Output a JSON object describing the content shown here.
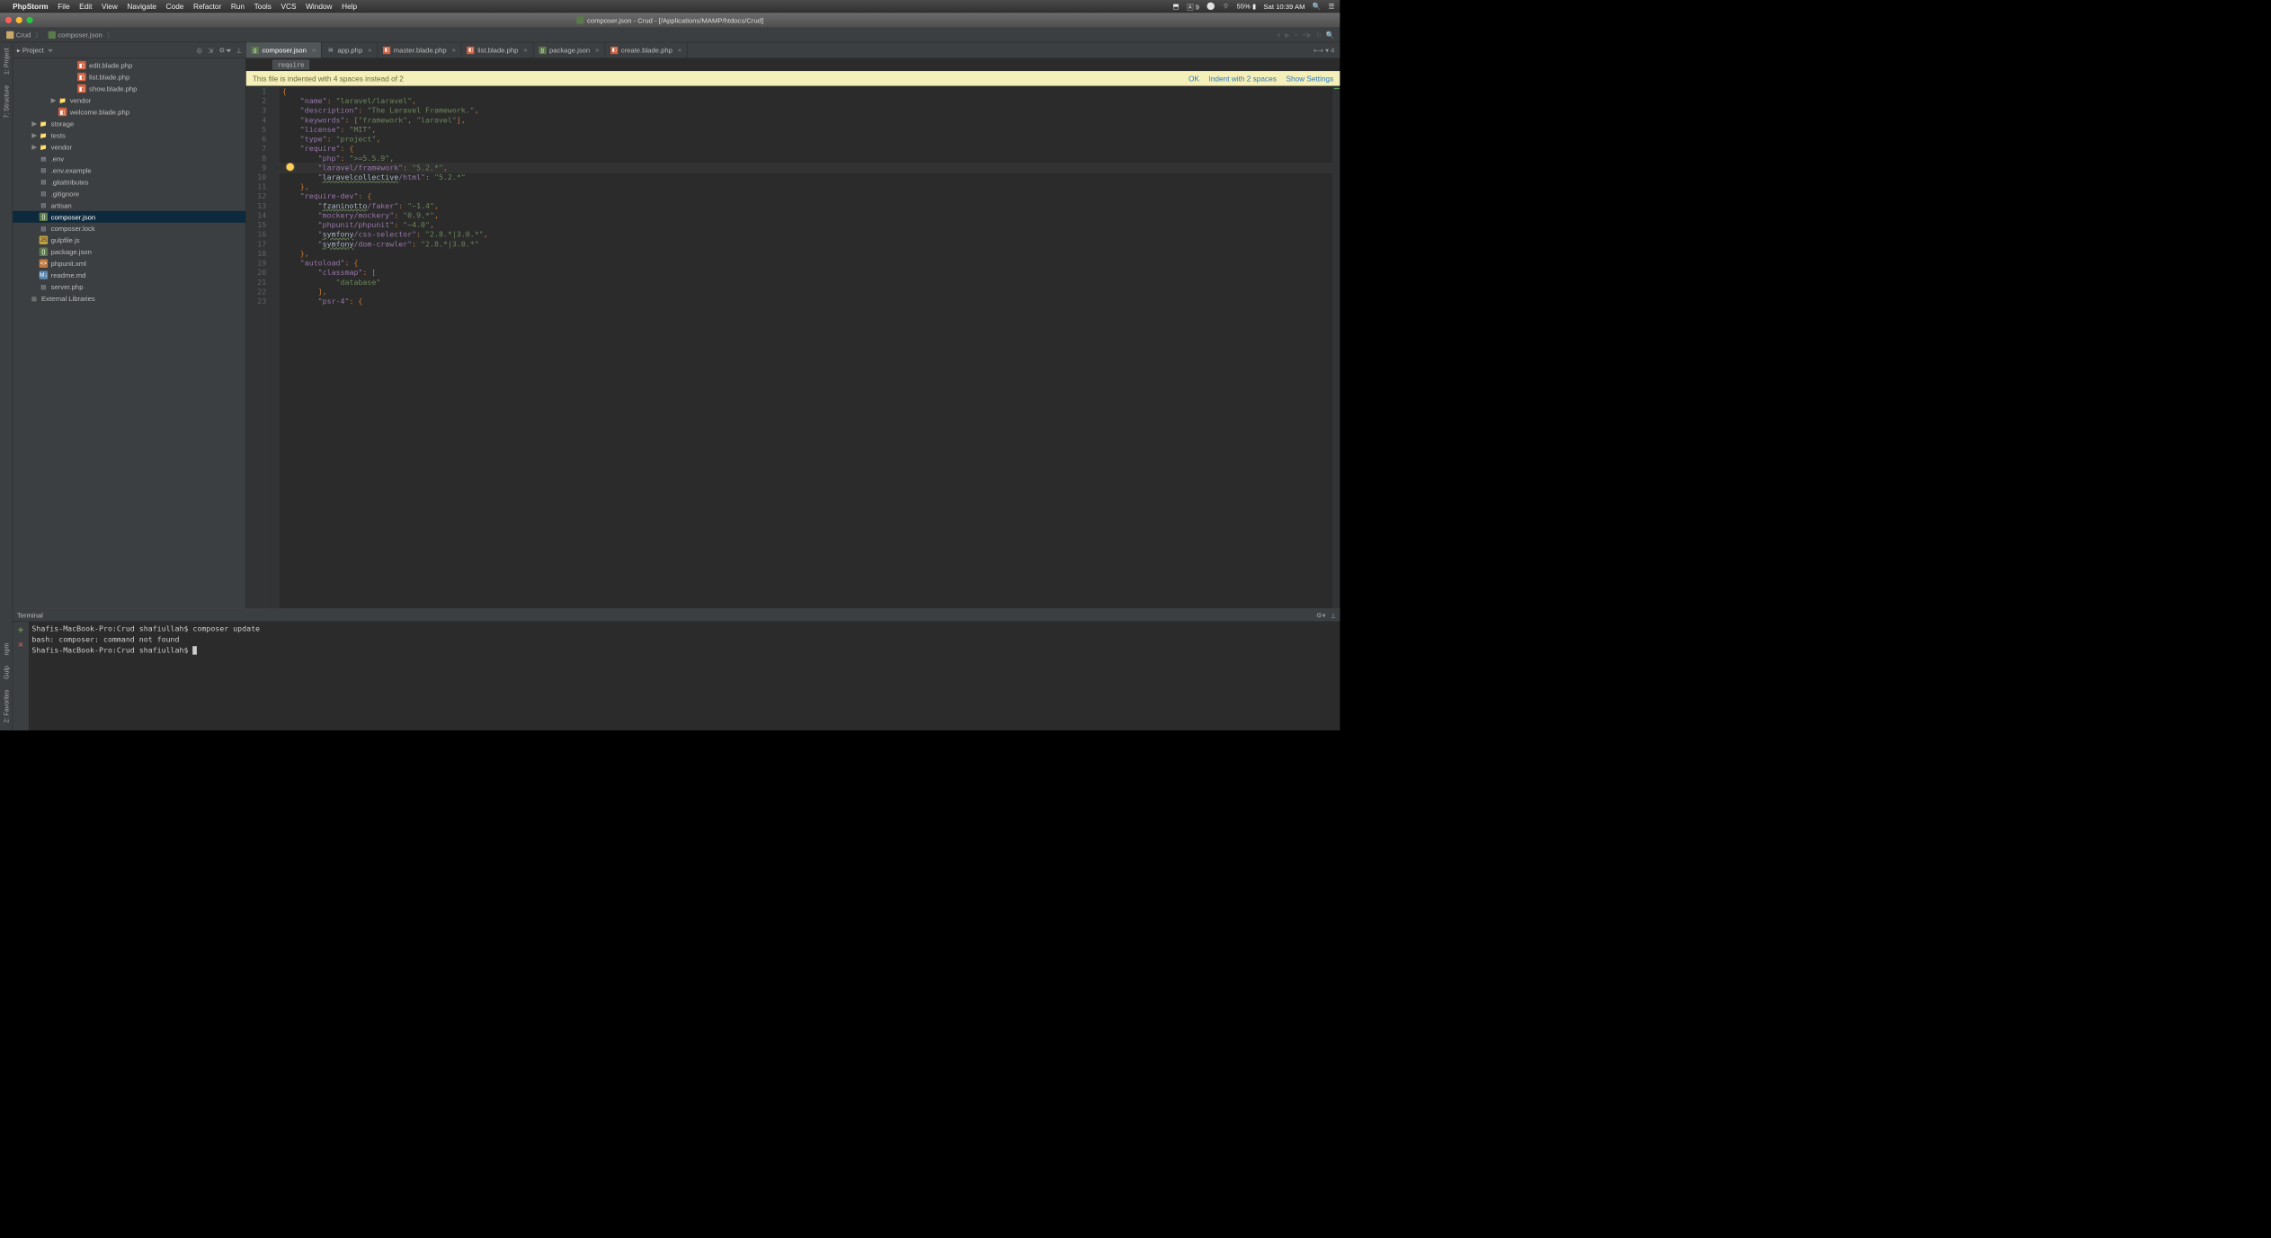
{
  "menubar": {
    "app": "PhpStorm",
    "items": [
      "File",
      "Edit",
      "View",
      "Navigate",
      "Code",
      "Refactor",
      "Run",
      "Tools",
      "VCS",
      "Window",
      "Help"
    ],
    "right": {
      "notif": "9",
      "battery": "55%",
      "time": "Sat 10:39 AM"
    }
  },
  "window": {
    "title": "composer.json - Crud - [/Applications/MAMP/htdocs/Crud]"
  },
  "breadcrumbs": {
    "root": "Crud",
    "file": "composer.json"
  },
  "sidebar": {
    "tabs": [
      "1: Project",
      "7: Structure"
    ],
    "bottom": [
      "npm",
      "Gulp",
      "2: Favorites"
    ]
  },
  "project": {
    "title": "Project",
    "tree": [
      {
        "d": 6,
        "t": "blade",
        "n": "edit.blade.php"
      },
      {
        "d": 6,
        "t": "blade",
        "n": "list.blade.php"
      },
      {
        "d": 6,
        "t": "blade",
        "n": "show.blade.php"
      },
      {
        "d": 4,
        "t": "folder",
        "n": "vendor",
        "arrow": "▶"
      },
      {
        "d": 4,
        "t": "blade",
        "n": "welcome.blade.php"
      },
      {
        "d": 2,
        "t": "folder",
        "n": "storage",
        "arrow": "▶"
      },
      {
        "d": 2,
        "t": "folder",
        "n": "tests",
        "arrow": "▶"
      },
      {
        "d": 2,
        "t": "folder",
        "n": "vendor",
        "arrow": "▶"
      },
      {
        "d": 2,
        "t": "file",
        "n": ".env"
      },
      {
        "d": 2,
        "t": "file",
        "n": ".env.example"
      },
      {
        "d": 2,
        "t": "file",
        "n": ".gitattributes"
      },
      {
        "d": 2,
        "t": "file",
        "n": ".gitignore"
      },
      {
        "d": 2,
        "t": "file",
        "n": "artisan"
      },
      {
        "d": 2,
        "t": "json",
        "n": "composer.json",
        "sel": true
      },
      {
        "d": 2,
        "t": "file",
        "n": "composer.lock"
      },
      {
        "d": 2,
        "t": "js",
        "n": "gulpfile.js"
      },
      {
        "d": 2,
        "t": "json",
        "n": "package.json"
      },
      {
        "d": 2,
        "t": "xml",
        "n": "phpunit.xml"
      },
      {
        "d": 2,
        "t": "md",
        "n": "readme.md"
      },
      {
        "d": 2,
        "t": "file",
        "n": "server.php"
      },
      {
        "d": 1,
        "t": "lib",
        "n": "External Libraries"
      }
    ]
  },
  "tabs": [
    {
      "label": "composer.json",
      "active": true,
      "ic": "json"
    },
    {
      "label": "app.php",
      "ic": "file"
    },
    {
      "label": "master.blade.php",
      "ic": "blade"
    },
    {
      "label": "list.blade.php",
      "ic": "blade"
    },
    {
      "label": "package.json",
      "ic": "json"
    },
    {
      "label": "create.blade.php",
      "ic": "blade"
    }
  ],
  "tabs_more": "4",
  "editor": {
    "breadcrumb": "require",
    "banner": {
      "msg": "This file is indented with 4 spaces instead of 2",
      "ok": "OK",
      "a1": "Indent with 2 spaces",
      "a2": "Show Settings"
    },
    "lines": [
      "1",
      "2",
      "3",
      "4",
      "5",
      "6",
      "7",
      "8",
      "9",
      "10",
      "11",
      "12",
      "13",
      "14",
      "15",
      "16",
      "17",
      "18",
      "19",
      "20",
      "21",
      "22",
      "23"
    ],
    "highlight_line": 9,
    "code_tokens": [
      [
        [
          "pun",
          "{"
        ]
      ],
      [
        [
          "",
          "    "
        ],
        [
          "key",
          "\"name\""
        ],
        [
          "pun",
          ": "
        ],
        [
          "str",
          "\"laravel/laravel\""
        ],
        [
          "pun",
          ","
        ]
      ],
      [
        [
          "",
          "    "
        ],
        [
          "key",
          "\"description\""
        ],
        [
          "pun",
          ": "
        ],
        [
          "str",
          "\"The Laravel Framework.\""
        ],
        [
          "pun",
          ","
        ]
      ],
      [
        [
          "",
          "    "
        ],
        [
          "key",
          "\"keywords\""
        ],
        [
          "pun",
          ": ["
        ],
        [
          "str",
          "\"framework\""
        ],
        [
          "pun",
          ", "
        ],
        [
          "str",
          "\"laravel\""
        ],
        [
          "pun",
          "],"
        ]
      ],
      [
        [
          "",
          "    "
        ],
        [
          "key",
          "\"license\""
        ],
        [
          "pun",
          ": "
        ],
        [
          "str",
          "\"MIT\""
        ],
        [
          "pun",
          ","
        ]
      ],
      [
        [
          "",
          "    "
        ],
        [
          "key",
          "\"type\""
        ],
        [
          "pun",
          ": "
        ],
        [
          "str",
          "\"project\""
        ],
        [
          "pun",
          ","
        ]
      ],
      [
        [
          "",
          "    "
        ],
        [
          "key",
          "\"require\""
        ],
        [
          "pun",
          ": {"
        ]
      ],
      [
        [
          "",
          "        "
        ],
        [
          "key",
          "\"php\""
        ],
        [
          "pun",
          ": "
        ],
        [
          "str",
          "\">=5.5.9\""
        ],
        [
          "pun",
          ","
        ]
      ],
      [
        [
          "",
          "        "
        ],
        [
          "key",
          "\"laravel/framework\""
        ],
        [
          "pun",
          ": "
        ],
        [
          "str",
          "\"5.2.*\""
        ],
        [
          "pun",
          ","
        ]
      ],
      [
        [
          "",
          "        "
        ],
        [
          "key",
          "\""
        ],
        [
          "und",
          "laravelcollective"
        ],
        [
          "key",
          "/html\""
        ],
        [
          "pun",
          ": "
        ],
        [
          "str",
          "\"5.2.*\""
        ]
      ],
      [
        [
          "",
          "    "
        ],
        [
          "pun",
          "},"
        ]
      ],
      [
        [
          "",
          "    "
        ],
        [
          "key",
          "\"require-dev\""
        ],
        [
          "pun",
          ": {"
        ]
      ],
      [
        [
          "",
          "        "
        ],
        [
          "key",
          "\""
        ],
        [
          "und",
          "fzaninotto"
        ],
        [
          "key",
          "/faker\""
        ],
        [
          "pun",
          ": "
        ],
        [
          "str",
          "\"~1.4\""
        ],
        [
          "pun",
          ","
        ]
      ],
      [
        [
          "",
          "        "
        ],
        [
          "key",
          "\"mockery/mockery\""
        ],
        [
          "pun",
          ": "
        ],
        [
          "str",
          "\"0.9.*\""
        ],
        [
          "pun",
          ","
        ]
      ],
      [
        [
          "",
          "        "
        ],
        [
          "key",
          "\"phpunit/phpunit\""
        ],
        [
          "pun",
          ": "
        ],
        [
          "str",
          "\"~4.0\""
        ],
        [
          "pun",
          ","
        ]
      ],
      [
        [
          "",
          "        "
        ],
        [
          "key",
          "\""
        ],
        [
          "und",
          "symfony"
        ],
        [
          "key",
          "/css-selector\""
        ],
        [
          "pun",
          ": "
        ],
        [
          "str",
          "\"2.8.*|3.0.*\""
        ],
        [
          "pun",
          ","
        ]
      ],
      [
        [
          "",
          "        "
        ],
        [
          "key",
          "\""
        ],
        [
          "und",
          "symfony"
        ],
        [
          "key",
          "/dom-crawler\""
        ],
        [
          "pun",
          ": "
        ],
        [
          "str",
          "\"2.8.*|3.0.*\""
        ]
      ],
      [
        [
          "",
          "    "
        ],
        [
          "pun",
          "},"
        ]
      ],
      [
        [
          "",
          "    "
        ],
        [
          "key",
          "\"autoload\""
        ],
        [
          "pun",
          ": {"
        ]
      ],
      [
        [
          "",
          "        "
        ],
        [
          "key",
          "\"classmap\""
        ],
        [
          "pun",
          ": ["
        ]
      ],
      [
        [
          "",
          "            "
        ],
        [
          "str",
          "\"database\""
        ]
      ],
      [
        [
          "",
          "        "
        ],
        [
          "pun",
          "],"
        ]
      ],
      [
        [
          "",
          "        "
        ],
        [
          "key",
          "\"psr-4\""
        ],
        [
          "pun",
          ": {"
        ]
      ]
    ]
  },
  "terminal": {
    "title": "Terminal",
    "lines": [
      "Shafis-MacBook-Pro:Crud shafiullah$ composer update",
      "bash: composer: command not found",
      "Shafis-MacBook-Pro:Crud shafiullah$ "
    ]
  }
}
